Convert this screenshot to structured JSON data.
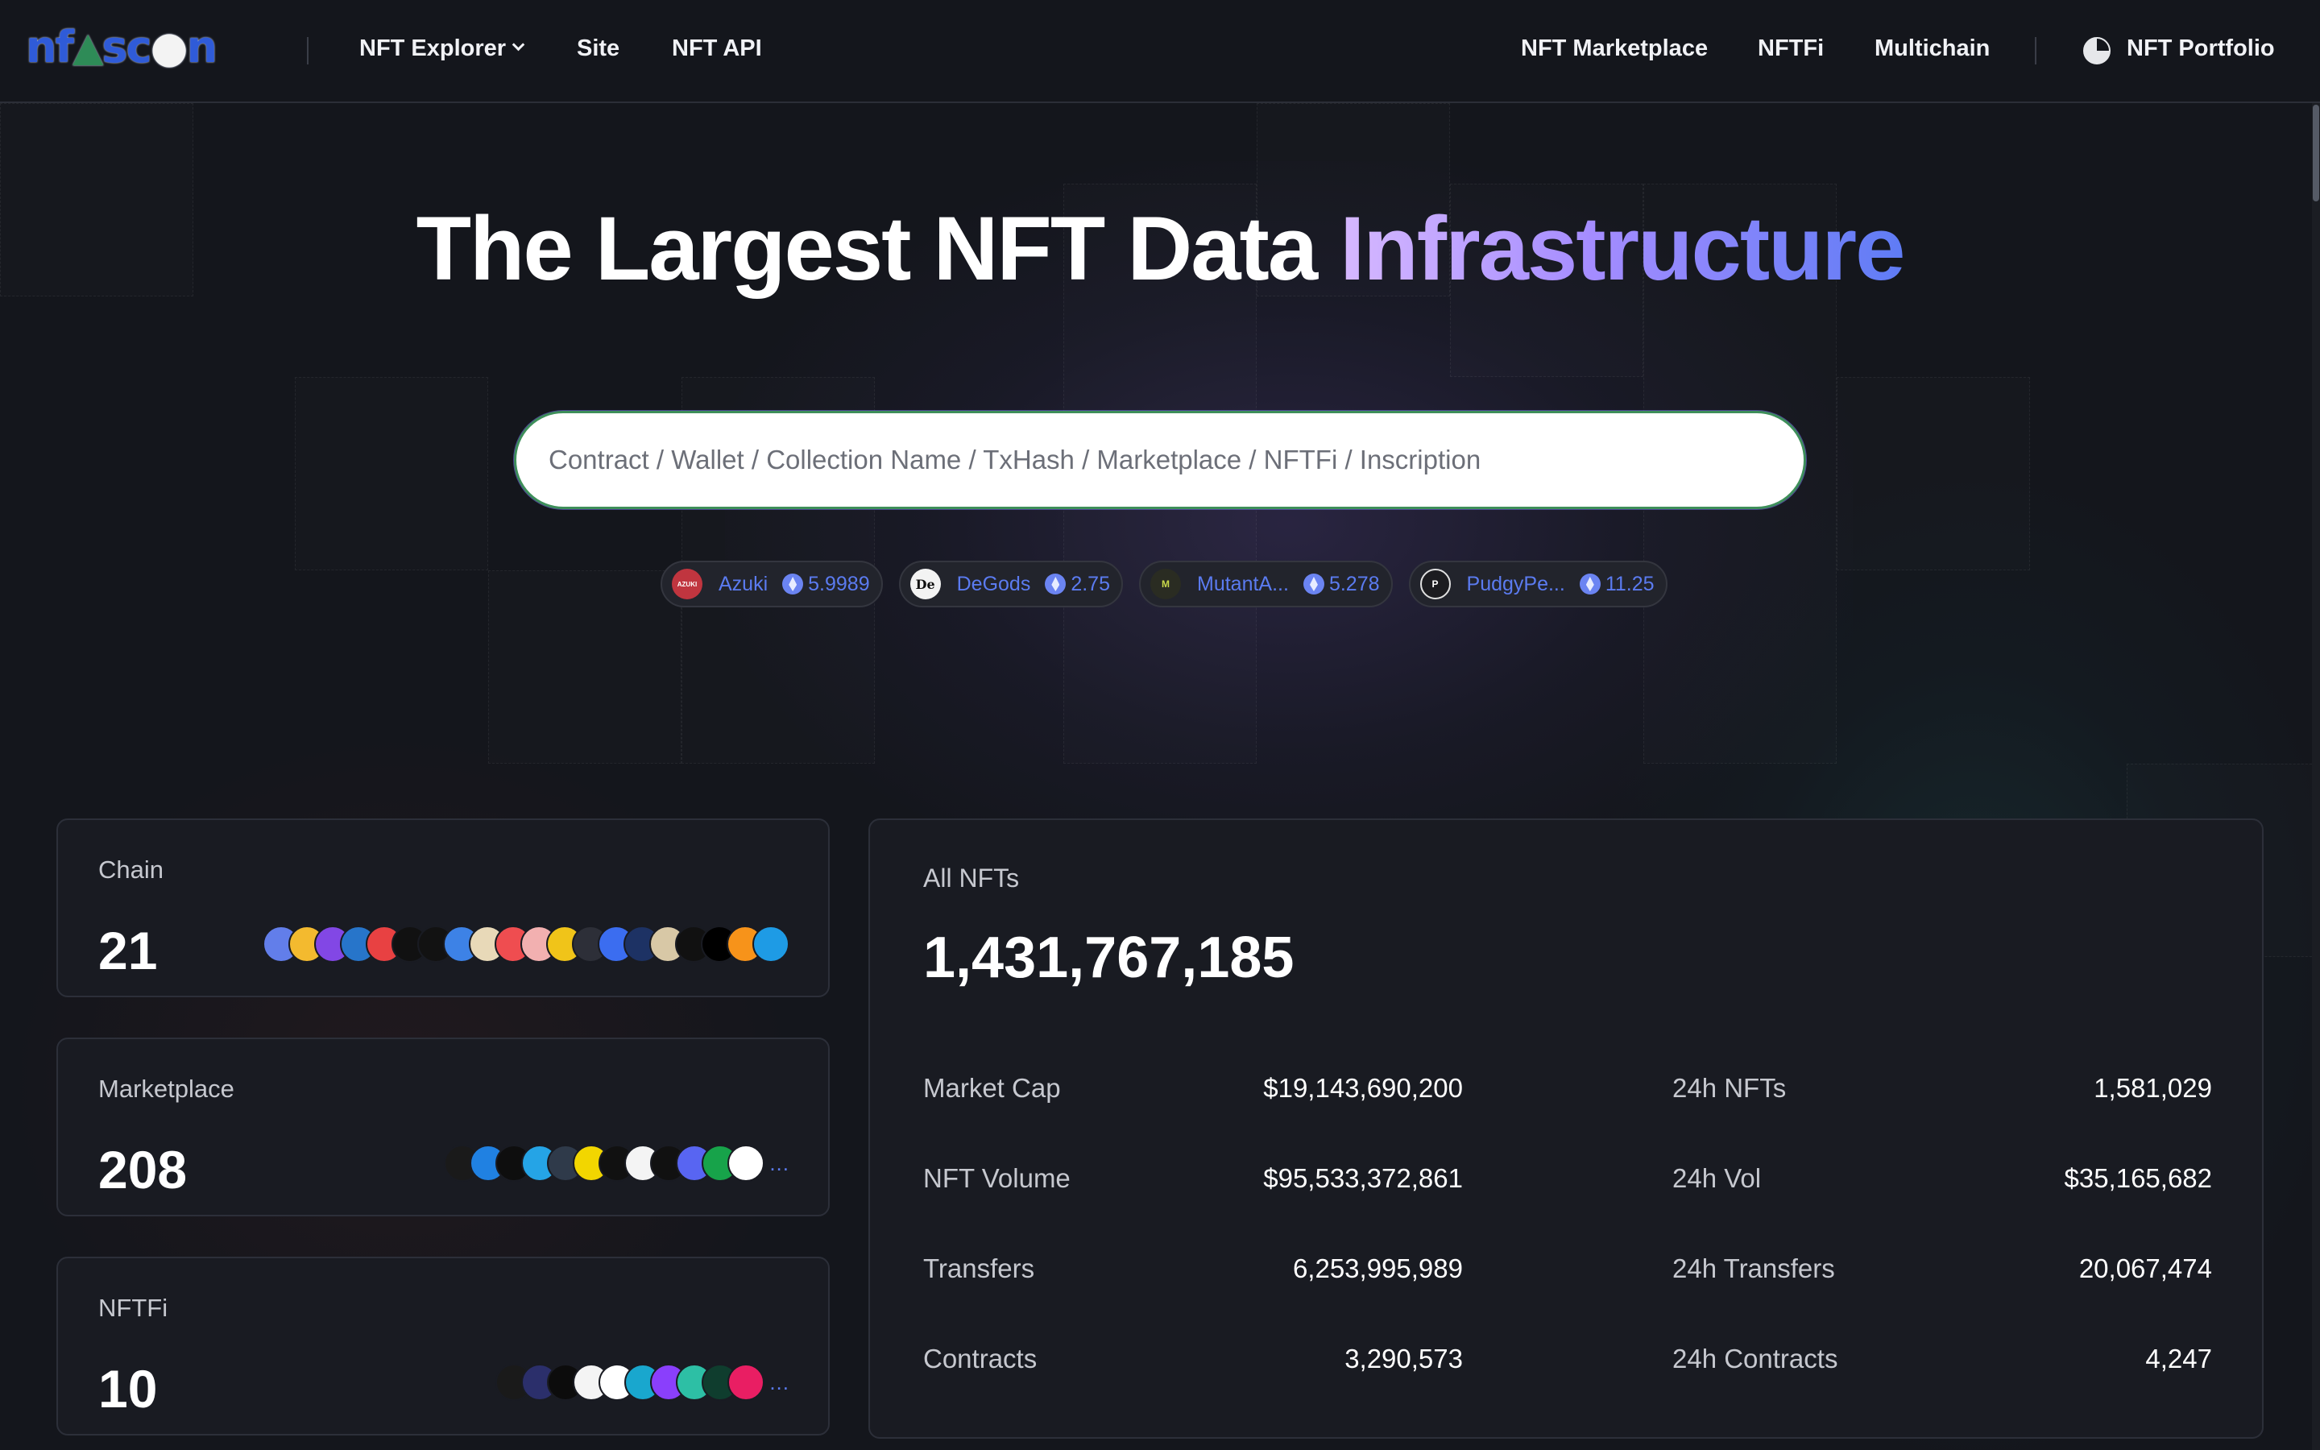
{
  "nav": {
    "logo_text": "nftscan",
    "explorer_label": "NFT Explorer",
    "site_label": "Site",
    "api_label": "NFT API",
    "marketplace_label": "NFT Marketplace",
    "nftfi_label": "NFTFi",
    "multichain_label": "Multichain",
    "portfolio_label": "NFT Portfolio"
  },
  "hero": {
    "title_main": "The Largest NFT Data",
    "title_accent": "Infrastructure"
  },
  "search": {
    "placeholder": "Contract / Wallet / Collection Name / TxHash / Marketplace / NFTFi / Inscription"
  },
  "trending": [
    {
      "name": "Azuki",
      "price": "5.9989",
      "avatar_color": "#c0353f",
      "avatar_text": "AZUKI"
    },
    {
      "name": "DeGods",
      "price": "2.75",
      "avatar_color": "#f3f3f3",
      "avatar_text": "De"
    },
    {
      "name": "MutantA...",
      "price": "5.278",
      "avatar_color": "#2a2c22",
      "avatar_text": "M"
    },
    {
      "name": "PudgyPe...",
      "price": "11.25",
      "avatar_color": "#1c1c20",
      "avatar_text": "P"
    }
  ],
  "cards": {
    "chain": {
      "label": "Chain",
      "value": "21"
    },
    "marketplace": {
      "label": "Marketplace",
      "value": "208",
      "more": "..."
    },
    "nftfi": {
      "label": "NFTFi",
      "value": "10",
      "more": "..."
    }
  },
  "icon_colors": {
    "chain": [
      "#627eea",
      "#f3ba2f",
      "#8247e5",
      "#2775ca",
      "#e84142",
      "#111111",
      "#121212",
      "#3d82e6",
      "#e8d9b8",
      "#ef4d50",
      "#f2b0b0",
      "#f0c419",
      "#2d2f38",
      "#3b6df0",
      "#1d3264",
      "#d8c8a6",
      "#111111",
      "#000000",
      "#f7931a",
      "#1e9be5"
    ],
    "marketplace": [
      "#1a1a1a",
      "#2081e2",
      "#0e0e0e",
      "#25a4e6",
      "#2f3a4a",
      "#f2d600",
      "#111111",
      "#f4f4f4",
      "#111111",
      "#5865f2",
      "#17a34a",
      "#ffffff"
    ],
    "nftfi": [
      "#1a1a1a",
      "#2b2f6b",
      "#0c0c0c",
      "#f4f4f4",
      "#ffffff",
      "#19a7ce",
      "#8a3ffc",
      "#2dbfa5",
      "#0f3d2e",
      "#e91e63"
    ]
  },
  "stats": {
    "label": "All NFTs",
    "total": "1,431,767,185",
    "left": [
      {
        "k": "Market Cap",
        "v": "$19,143,690,200"
      },
      {
        "k": "NFT Volume",
        "v": "$95,533,372,861"
      },
      {
        "k": "Transfers",
        "v": "6,253,995,989"
      },
      {
        "k": "Contracts",
        "v": "3,290,573"
      }
    ],
    "right": [
      {
        "k": "24h NFTs",
        "v": "1,581,029"
      },
      {
        "k": "24h Vol",
        "v": "$35,165,682"
      },
      {
        "k": "24h Transfers",
        "v": "20,067,474"
      },
      {
        "k": "24h Contracts",
        "v": "4,247"
      }
    ]
  }
}
